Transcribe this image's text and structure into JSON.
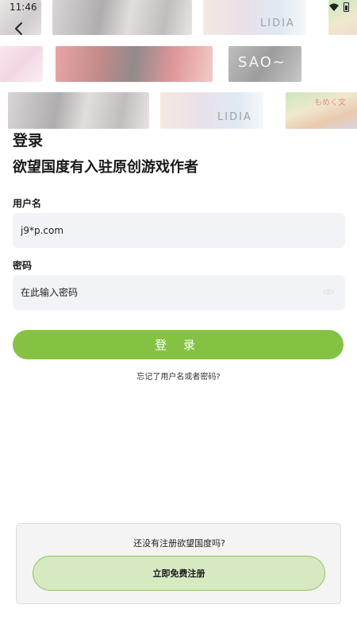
{
  "status_bar": {
    "time": "11:46",
    "icons": [
      "wifi-icon",
      "battery-icon"
    ]
  },
  "nav": {
    "back_icon": "chevron-left-icon"
  },
  "banner": {
    "tiles": [
      {
        "caption": ""
      },
      {
        "caption": ""
      },
      {
        "caption": "LIDIA"
      },
      {
        "caption": ""
      },
      {
        "caption": ""
      },
      {
        "caption": ""
      },
      {
        "caption": "SAO~"
      },
      {
        "caption": ""
      },
      {
        "caption": "LIDIA"
      },
      {
        "caption": "もめく文"
      }
    ]
  },
  "login": {
    "title": "登录",
    "subtitle": "欲望国度有入驻原创游戏作者",
    "username_label": "用户名",
    "username_value": "j9*p.com",
    "password_label": "密码",
    "password_placeholder": "在此输入密码",
    "submit_label": "登 录",
    "forgot_link": "忘记了用户名或者密码?"
  },
  "register": {
    "question": "还没有注册欲望国度吗?",
    "button_label": "立即免费注册"
  },
  "colors": {
    "accent": "#85c244",
    "register_button_bg": "#d6e9c1",
    "field_bg": "#f2f3f7"
  }
}
